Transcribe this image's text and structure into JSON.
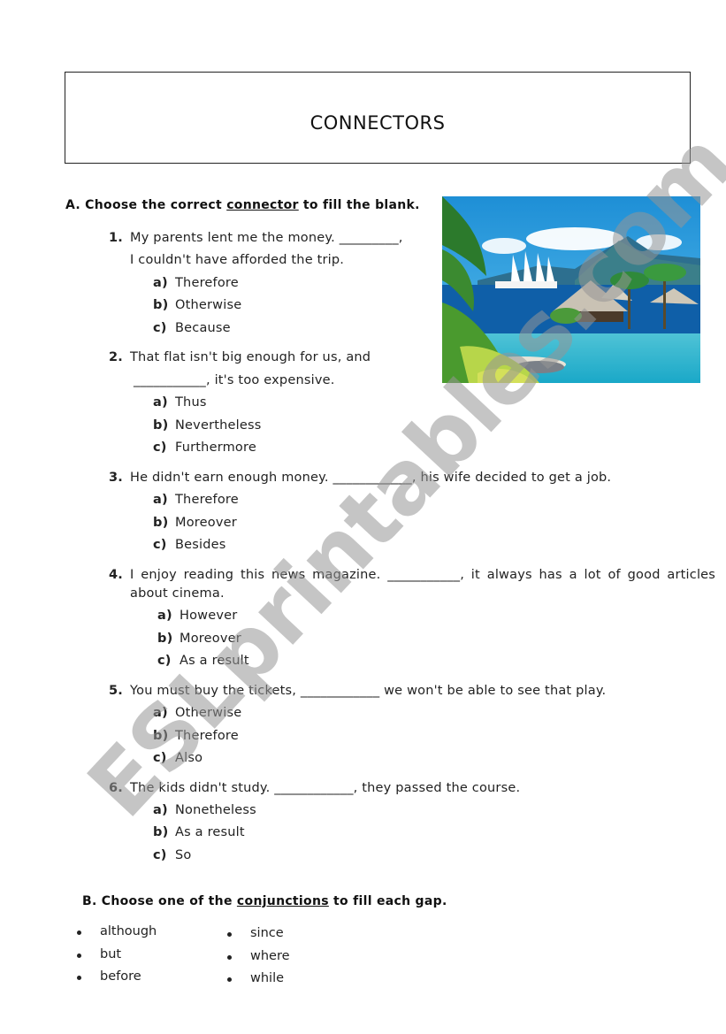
{
  "title": "CONNECTORS",
  "section_a": {
    "prefix": "A. Choose the correct ",
    "underlined": "connector",
    "suffix": " to fill the blank."
  },
  "photo": {
    "description": "tropical-resort-beach-with-sailing-ship"
  },
  "questions": [
    {
      "number": "1.",
      "lines": [
        "My parents lent me the money. _________,",
        "I couldn't have afforded the trip."
      ],
      "options": [
        {
          "letter": "a)",
          "text": "Therefore"
        },
        {
          "letter": "b)",
          "text": "Otherwise"
        },
        {
          "letter": "c)",
          "text": "Because"
        }
      ]
    },
    {
      "number": "2.",
      "lines": [
        "That flat isn't big enough for us, and",
        "___________, it's too expensive."
      ],
      "options": [
        {
          "letter": "a)",
          "text": "Thus"
        },
        {
          "letter": "b)",
          "text": "Nevertheless"
        },
        {
          "letter": "c)",
          "text": "Furthermore"
        }
      ]
    },
    {
      "number": "3.",
      "lines": [
        "He didn't earn enough money. ____________, his wife decided to get a job."
      ],
      "options": [
        {
          "letter": "a)",
          "text": "Therefore"
        },
        {
          "letter": "b)",
          "text": "Moreover"
        },
        {
          "letter": "c)",
          "text": "Besides"
        }
      ]
    },
    {
      "number": "4.",
      "lines": [
        "I enjoy reading this news magazine. ___________, it always has a lot of good articles",
        "about cinema."
      ],
      "options": [
        {
          "letter": "a)",
          "text": "However"
        },
        {
          "letter": "b)",
          "text": "Moreover"
        },
        {
          "letter": "c)",
          "text": "As a result"
        }
      ]
    },
    {
      "number": "5.",
      "lines": [
        "You must buy the tickets, ____________ we won't be able to see that play."
      ],
      "options": [
        {
          "letter": "a)",
          "text": "Otherwise"
        },
        {
          "letter": "b)",
          "text": "Therefore"
        },
        {
          "letter": "c)",
          "text": "Also"
        }
      ]
    },
    {
      "number": "6.",
      "lines": [
        "The kids didn't study. ____________, they passed the course."
      ],
      "options": [
        {
          "letter": "a)",
          "text": "Nonetheless"
        },
        {
          "letter": "b)",
          "text": "As a result"
        },
        {
          "letter": "c)",
          "text": "So"
        }
      ]
    }
  ],
  "section_b": {
    "prefix": "B. Choose one of the ",
    "underlined": "conjunctions",
    "suffix": " to fill each gap.",
    "column_1": [
      "although",
      "but",
      "before"
    ],
    "column_2": [
      "since",
      "where",
      "while"
    ]
  },
  "watermark": "ESLprintables.com"
}
